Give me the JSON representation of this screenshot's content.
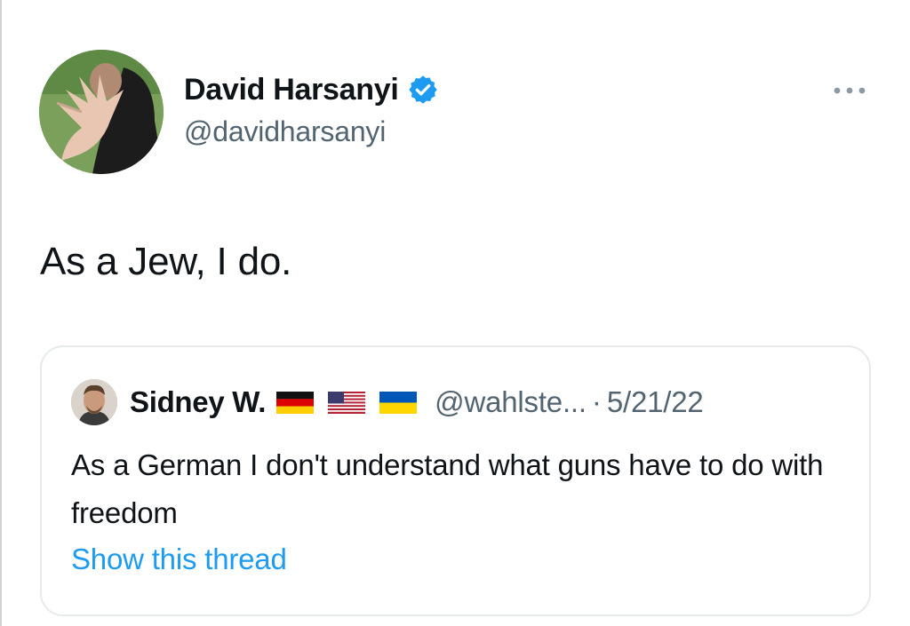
{
  "tweet": {
    "author": {
      "name": "David Harsanyi",
      "handle": "@davidharsanyi",
      "verified": true,
      "avatar_icon": "user-avatar-photo"
    },
    "text": "As a Jew, I do.",
    "more_icon": "more-horizontal-icon"
  },
  "quote": {
    "author": {
      "name": "Sidney W.",
      "handle": "@wahlste...",
      "flags": [
        "germany-flag-icon",
        "usa-flag-icon",
        "ukraine-flag-icon"
      ],
      "avatar_icon": "user-avatar-photo"
    },
    "separator": "·",
    "date": "5/21/22",
    "text": "As a German I don't understand what guns have to do with freedom",
    "show_thread": "Show this thread"
  },
  "colors": {
    "text_primary": "#0f1419",
    "text_secondary": "#536471",
    "link": "#1d9bf0",
    "verified": "#1d9bf0",
    "border": "#e7eaec"
  }
}
